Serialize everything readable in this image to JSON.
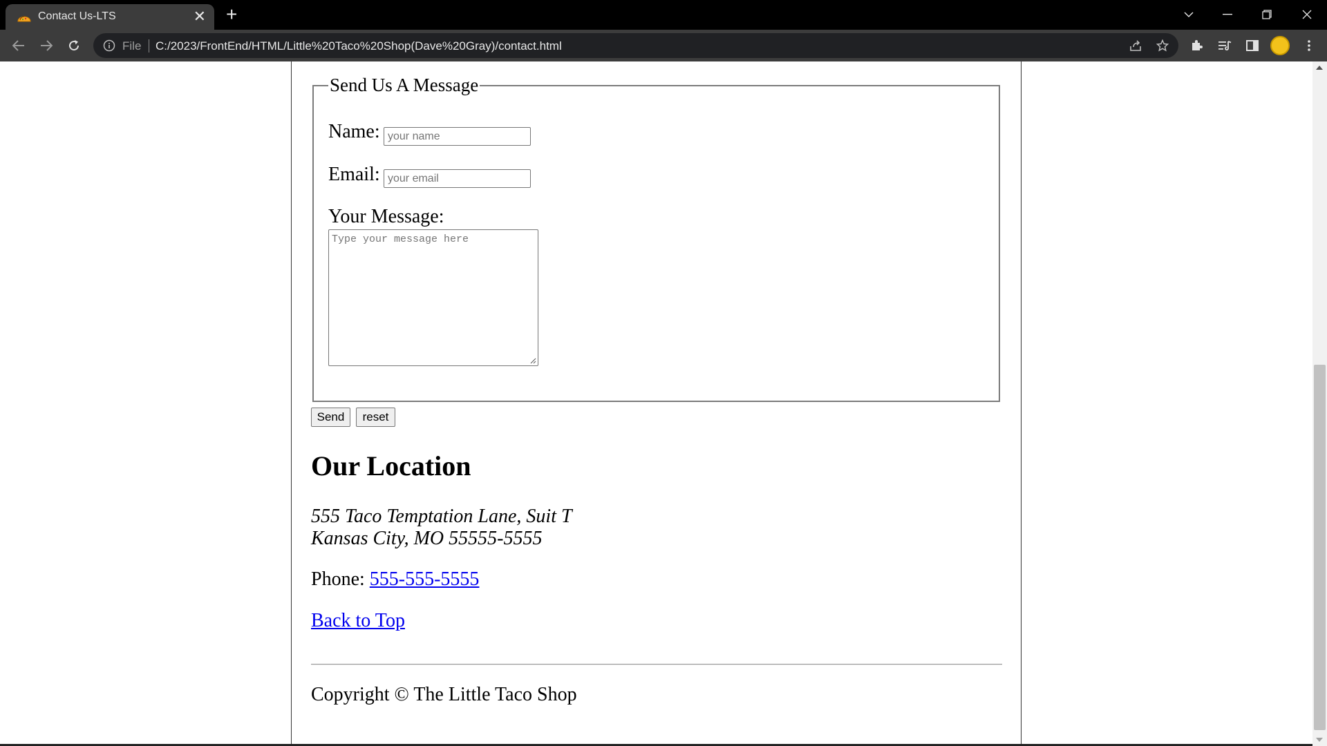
{
  "browser": {
    "tab_title": "Contact Us-LTS",
    "new_tab_symbol": "+",
    "close_symbol": "✕",
    "scheme_label": "File",
    "url": "C:/2023/FrontEnd/HTML/Little%20Taco%20Shop(Dave%20Gray)/contact.html"
  },
  "form": {
    "legend": "Send Us A Message",
    "name_label": "Name:",
    "name_placeholder": "your name",
    "email_label": "Email:",
    "email_placeholder": "your email",
    "message_label": "Your Message:",
    "message_placeholder": "Type your message here",
    "send_label": "Send",
    "reset_label": "reset"
  },
  "location": {
    "heading": "Our Location",
    "address_line1": "555 Taco Temptation Lane, Suit T",
    "address_line2": "Kansas City, MO 55555-5555",
    "phone_label": "Phone: ",
    "phone_number": "555-555-5555"
  },
  "back_to_top": "Back to Top",
  "footer": {
    "copyright": "Copyright © The Little Taco Shop"
  },
  "colors": {
    "link": "#0000ee",
    "chrome_dark": "#3c3c3c",
    "omnibox": "#202124"
  }
}
